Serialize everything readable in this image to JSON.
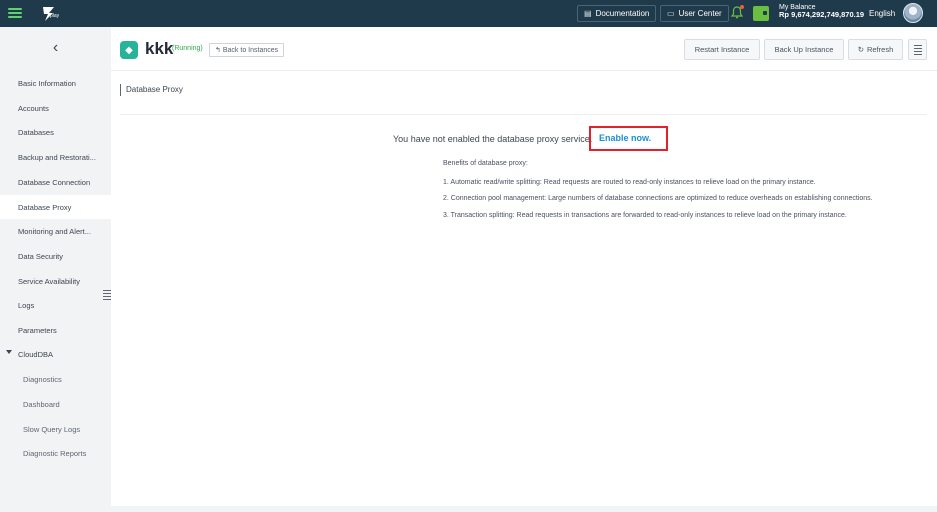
{
  "topbar": {
    "logo_text": "play",
    "documentation_label": "Documentation",
    "user_center_label": "User Center",
    "balance_label": "My Balance",
    "balance_amount": "Rp 9,674,292,749,870.19",
    "language": "English"
  },
  "sidebar": {
    "back_label": "‹",
    "items": [
      {
        "label": "Basic Information"
      },
      {
        "label": "Accounts"
      },
      {
        "label": "Databases"
      },
      {
        "label": "Backup and Restorati..."
      },
      {
        "label": "Database Connection"
      },
      {
        "label": "Database Proxy"
      },
      {
        "label": "Monitoring and Alert..."
      },
      {
        "label": "Data Security"
      },
      {
        "label": "Service Availability"
      },
      {
        "label": "Logs"
      },
      {
        "label": "Parameters"
      },
      {
        "label": "CloudDBA"
      }
    ],
    "sub_items": [
      {
        "label": "Diagnostics"
      },
      {
        "label": "Dashboard"
      },
      {
        "label": "Slow Query Logs"
      },
      {
        "label": "Diagnostic Reports"
      }
    ]
  },
  "header": {
    "instance_name": "kkk",
    "instance_status": "(Running)",
    "back_label": "Back to Instances",
    "restart_label": "Restart Instance",
    "backup_label": "Back Up Instance",
    "refresh_label": "Refresh"
  },
  "content": {
    "section_title": "Database Proxy",
    "notice_text": "You have not enabled the database proxy service.",
    "enable_link": "Enable now.",
    "benefits_title": "Benefits of database proxy:",
    "benefits": [
      "1. Automatic read/write splitting: Read requests are routed to read-only instances to relieve load on the primary instance.",
      "2. Connection pool management: Large numbers of database connections are optimized to reduce overheads on establishing connections.",
      "3. Transaction splitting: Read requests in transactions are forwarded to read-only instances to relieve load on the primary instance."
    ]
  },
  "colors": {
    "topbar_bg": "#1f3a4a",
    "link": "#1a8fd6",
    "highlight": "#e2212a",
    "running": "#2ea94d"
  }
}
